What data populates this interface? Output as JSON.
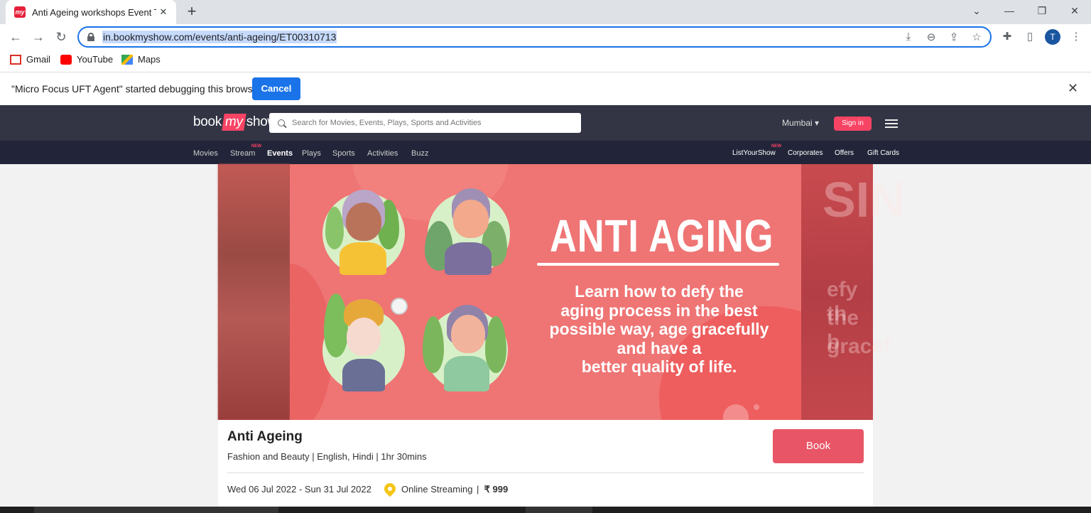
{
  "browser": {
    "tab_title": "Anti Ageing workshops Event Tic",
    "favicon_text": "my",
    "url": "in.bookmyshow.com/events/anti-ageing/ET00310713",
    "profile_initial": "T",
    "bookmarks": [
      {
        "label": "Gmail",
        "icon": "gmail-icon"
      },
      {
        "label": "YouTube",
        "icon": "youtube-icon"
      },
      {
        "label": "Maps",
        "icon": "maps-icon"
      }
    ],
    "infobar_text": "\"Micro Focus UFT Agent\" started debugging this browser",
    "infobar_cancel": "Cancel"
  },
  "site": {
    "logo_book": "book",
    "logo_my": "my",
    "logo_show": "show",
    "search_placeholder": "Search for Movies, Events, Plays, Sports and Activities",
    "city": "Mumbai ▾",
    "signin": "Sign in",
    "nav": [
      "Movies",
      "Stream",
      "Events",
      "Plays",
      "Sports",
      "Activities",
      "Buzz"
    ],
    "nav_active": "Events",
    "new_tag": "NEW",
    "nav_right": [
      "ListYourShow",
      "Corporates",
      "Offers",
      "Gift Cards"
    ]
  },
  "banner": {
    "headline": "ANTI AGING",
    "tagline_lines": [
      "Learn how to defy the",
      "aging process in the best",
      "possible way, age gracefully",
      "and have a",
      "better quality of life."
    ],
    "colors": {
      "primary": "#ef7474",
      "dark": "#ee5e5e"
    }
  },
  "event": {
    "title": "Anti Ageing",
    "meta": "Fashion and Beauty | English, Hindi | 1hr 30mins",
    "book_label": "Book",
    "dates": "Wed 06 Jul 2022 - Sun 31 Jul 2022",
    "venue": "Online Streaming",
    "price_sep": "|",
    "price": "₹ 999"
  },
  "accent": "#f84464"
}
